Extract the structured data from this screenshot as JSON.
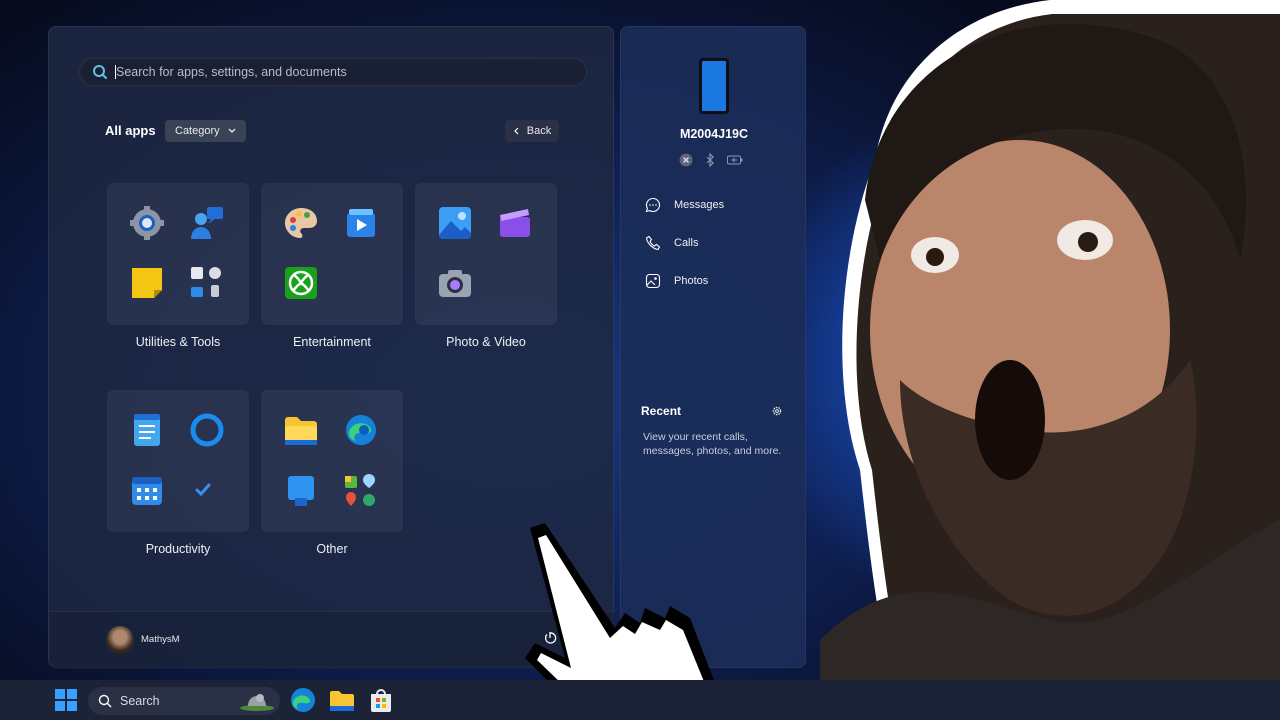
{
  "start_menu": {
    "search": {
      "placeholder": "Search for apps, settings, and documents"
    },
    "header": {
      "title": "All apps",
      "category_label": "Category",
      "back_label": "Back"
    },
    "folders": [
      {
        "label": "Utilities & Tools"
      },
      {
        "label": "Entertainment"
      },
      {
        "label": "Photo & Video"
      },
      {
        "label": "Productivity"
      },
      {
        "label": "Other"
      }
    ],
    "user": {
      "name": "MathysM"
    }
  },
  "phone_panel": {
    "device_name": "M2004J19C",
    "items": [
      {
        "label": "Messages",
        "icon": "message-icon"
      },
      {
        "label": "Calls",
        "icon": "phone-icon"
      },
      {
        "label": "Photos",
        "icon": "photo-icon"
      }
    ],
    "recent": {
      "title": "Recent",
      "description": "View your recent calls, messages, photos, and more."
    }
  },
  "taskbar": {
    "search_label": "Search"
  },
  "colors": {
    "accent": "#1a78e0",
    "panel": "#1b2d58",
    "taskbar": "#1d2336"
  }
}
